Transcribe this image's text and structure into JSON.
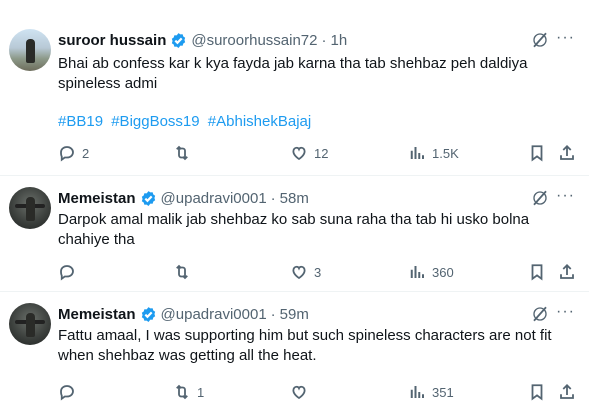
{
  "tweets": [
    {
      "name": "suroor hussain",
      "handle": "@suroorhussain72",
      "dot": "·",
      "time": "1h",
      "text": "Bhai ab confess kar k kya fayda jab karna tha tab shehbaz peh daldiya spineless admi",
      "hashtags": [
        "#BB19",
        "#BiggBoss19",
        "#AbhishekBajaj"
      ],
      "replies": "2",
      "reposts": "",
      "likes": "12",
      "views": "1.5K"
    },
    {
      "name": "Memeistan",
      "handle": "@upadravi0001",
      "dot": "·",
      "time": "58m",
      "text": "Darpok amal malik jab shehbaz ko sab suna raha tha tab hi usko bolna chahiye tha",
      "replies": "",
      "reposts": "",
      "likes": "3",
      "views": "360"
    },
    {
      "name": "Memeistan",
      "handle": "@upadravi0001",
      "dot": "·",
      "time": "59m",
      "text": "Fattu amaal, I was supporting him but such spineless characters are not fit when shehbaz was getting all the heat.",
      "replies": "",
      "reposts": "1",
      "likes": "",
      "views": "351"
    }
  ],
  "colors": {
    "verified": "#1d9bf0",
    "hashtag": "#1d9bf0",
    "muted": "#536471"
  },
  "icons": [
    "verified-badge-icon",
    "grok-icon",
    "more-icon",
    "reply-icon",
    "repost-icon",
    "like-icon",
    "views-icon",
    "bookmark-icon",
    "share-icon"
  ]
}
